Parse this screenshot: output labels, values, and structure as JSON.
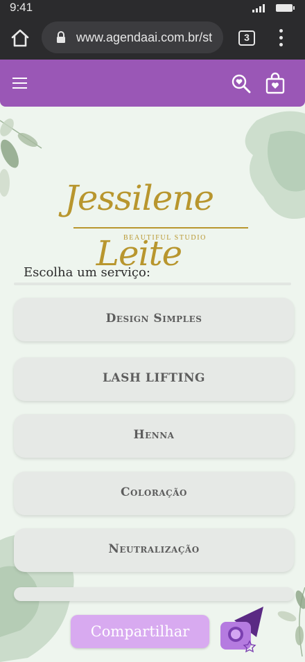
{
  "status_bar": {
    "time": "9:41"
  },
  "browser": {
    "url": "www.agendaai.com.br/st",
    "tab_count": "3"
  },
  "header": {
    "icons": [
      "menu-icon",
      "search-heart-icon",
      "shopping-bag-icon"
    ],
    "color": "#9a57b6"
  },
  "logo": {
    "title": "Jessilene Leite",
    "subtitle": "BEAUTIFUL STUDIO"
  },
  "services": {
    "heading": "Escolha um serviço:",
    "items": [
      "Design Simples",
      "LASH LIFTING",
      "Henna",
      "Coloração",
      "Neutralização",
      ""
    ]
  },
  "footer": {
    "share_label": "Compartilhar"
  }
}
